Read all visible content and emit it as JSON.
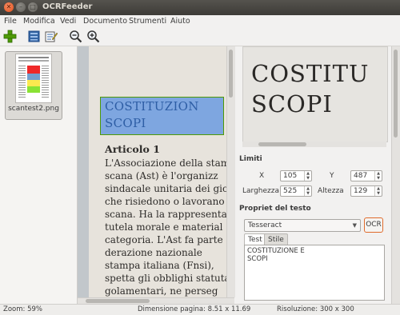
{
  "window": {
    "title": "OCRFeeder"
  },
  "menubar": {
    "items": [
      "File",
      "Modifica",
      "Vedi",
      "Documento",
      "Strumenti",
      "Aiuto"
    ]
  },
  "toolbar": {
    "icons": [
      "add-icon",
      "image-icon",
      "edit-icon",
      "zoom-out-icon",
      "zoom-in-icon"
    ]
  },
  "sidebar": {
    "thumbnail_name": "scantest2.png"
  },
  "document": {
    "selected_heading": [
      "COSTITUZION",
      "SCOPI"
    ],
    "article_title": "Articolo 1",
    "lines": [
      "L'Associazione della stam",
      "scana (Ast) è l'organizz",
      "sindacale unitaria dei gior",
      "che risiedono o lavorano",
      "scana. Ha la rappresentar",
      "tutela morale e material",
      "categoria. L'Ast fa parte de",
      "derazione   nazionale",
      "stampa italiana (Fnsi),",
      "spetta gli obblighi statuta",
      "golamentari,  ne  perseg"
    ]
  },
  "preview": {
    "lines": [
      "COSTITU",
      "SCOPI"
    ]
  },
  "limits": {
    "section_title": "Limiti",
    "x_label": "X",
    "x_value": "105",
    "y_label": "Y",
    "y_value": "487",
    "width_label": "Larghezza",
    "width_value": "525",
    "height_label": "Altezza",
    "height_value": "129"
  },
  "text_props": {
    "section_title": "Propriet del testo",
    "engine": "Tesseract",
    "ocr_label": "OCR",
    "tabs": [
      "Test",
      "Stile"
    ],
    "content": "COSTITUZIONE E\nSCOPI"
  },
  "status": {
    "zoom": "Zoom: 59%",
    "page_size": "Dimensione pagina: 8.51 x 11.69",
    "resolution": "Risoluzione: 300 x 300"
  },
  "colors": {
    "selection": "#7ea6e0",
    "selection_border": "#4e9a06",
    "ocr_border": "#e06b2c",
    "close_button": "#e2511c"
  }
}
